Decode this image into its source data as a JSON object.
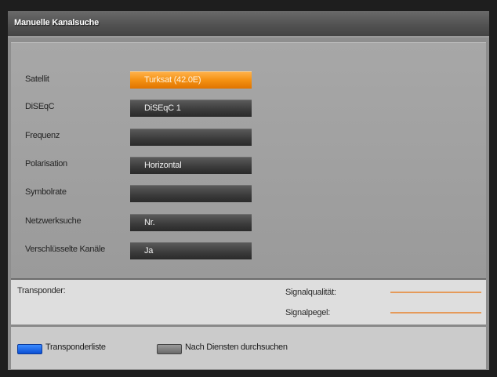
{
  "window": {
    "title": "Manuelle Kanalsuche"
  },
  "form": {
    "rows": [
      {
        "label": "Satellit",
        "value": "Turksat (42.0E)",
        "active": true
      },
      {
        "label": "DiSEqC",
        "value": "DiSEqC 1",
        "active": false
      },
      {
        "label": "Frequenz",
        "value": "",
        "active": false
      },
      {
        "label": "Polarisation",
        "value": "Horizontal",
        "active": false
      },
      {
        "label": "Symbolrate",
        "value": "",
        "active": false
      },
      {
        "label": "Netzwerksuche",
        "value": "Nr.",
        "active": false
      },
      {
        "label": "Verschlüsselte Kanäle",
        "value": "Ja",
        "active": false
      }
    ]
  },
  "info": {
    "transponder_label": "Transponder:",
    "signal_quality_label": "Signalqualität:",
    "signal_level_label": "Signalpegel:"
  },
  "footer": {
    "blue_key_label": "Transponderliste",
    "gray_key_label": "Nach Diensten durchsuchen"
  },
  "colors": {
    "accent": "#f49012",
    "field_bg": "#3c3c3c",
    "blue_key": "#1e6cf0",
    "meter": "#e59a5a"
  }
}
